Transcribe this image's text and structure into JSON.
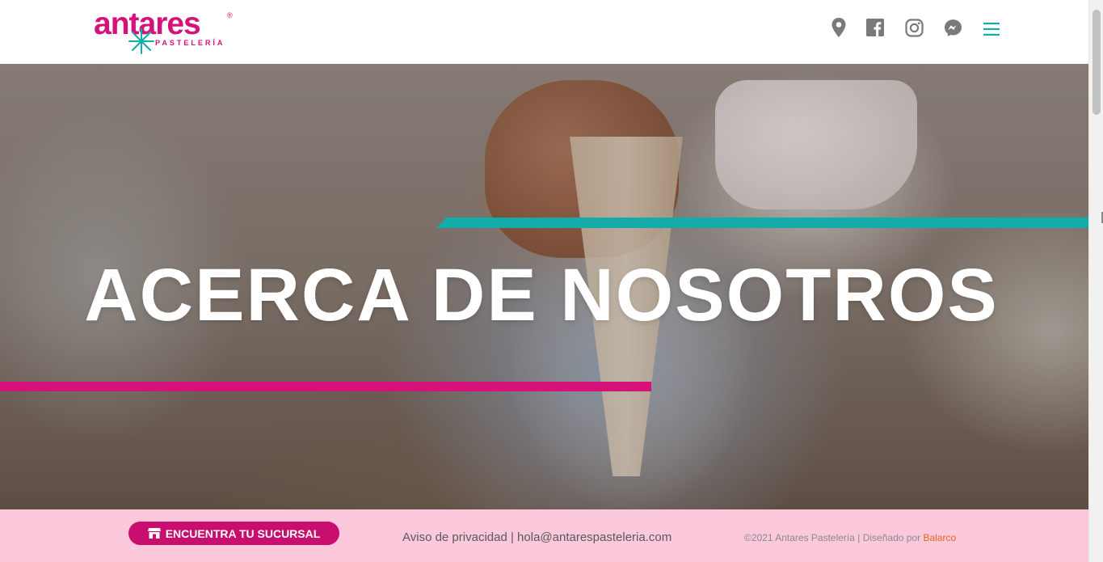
{
  "header": {
    "logo": {
      "wordmark": "antares",
      "registered": "®",
      "subtitle": "PASTELERÍA"
    },
    "icons": [
      "map-pin-icon",
      "facebook-icon",
      "instagram-icon",
      "messenger-icon",
      "menu-icon"
    ],
    "colors": {
      "brand": "#d6127a",
      "accent": "#13aca8",
      "icon_gray": "#7a7a7a"
    }
  },
  "hero": {
    "title": "ACERCA DE NOSOTROS",
    "stripe_colors": {
      "teal": "#13aca8",
      "pink": "#d6127a"
    }
  },
  "footer": {
    "cta_icon": "store-icon",
    "cta_label": "ENCUENTRA TU SUCURSAL",
    "privacy_label": "Aviso de privacidad",
    "separator": " | ",
    "email": "hola@antarespasteleria.com",
    "copyright_text": "©2021 Antares Pastelería | Diseñado por ",
    "designer": "Balarco",
    "colors": {
      "background": "#fbc8dc",
      "button": "#c80e6e",
      "designer_link": "#e8651e"
    }
  }
}
